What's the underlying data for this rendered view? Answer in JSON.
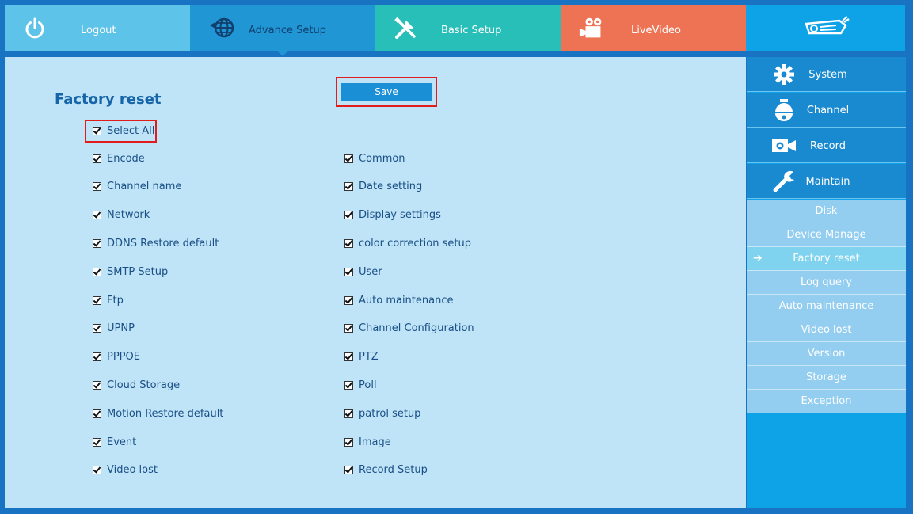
{
  "topnav": {
    "logout": "Logout",
    "advance_setup": "Advance Setup",
    "basic_setup": "Basic Setup",
    "live_video": "LiveVideo"
  },
  "main": {
    "title": "Factory reset",
    "save_label": "Save",
    "select_all": {
      "label": "Select All",
      "checked": true
    },
    "left_items": [
      {
        "label": "Encode",
        "checked": true
      },
      {
        "label": "Channel name",
        "checked": true
      },
      {
        "label": "Network",
        "checked": true
      },
      {
        "label": "DDNS Restore default",
        "checked": true
      },
      {
        "label": "SMTP Setup",
        "checked": true
      },
      {
        "label": "Ftp",
        "checked": true
      },
      {
        "label": "UPNP",
        "checked": true
      },
      {
        "label": "PPPOE",
        "checked": true
      },
      {
        "label": "Cloud Storage",
        "checked": true
      },
      {
        "label": "Motion Restore default",
        "checked": true
      },
      {
        "label": "Event",
        "checked": true
      },
      {
        "label": "Video lost",
        "checked": true
      }
    ],
    "right_items": [
      {
        "label": "Common",
        "checked": true
      },
      {
        "label": "Date setting",
        "checked": true
      },
      {
        "label": "Display settings",
        "checked": true
      },
      {
        "label": "color correction setup",
        "checked": true
      },
      {
        "label": "User",
        "checked": true
      },
      {
        "label": "Auto maintenance",
        "checked": true
      },
      {
        "label": "Channel Configuration",
        "checked": true
      },
      {
        "label": "PTZ",
        "checked": true
      },
      {
        "label": "Poll",
        "checked": true
      },
      {
        "label": "patrol setup",
        "checked": true
      },
      {
        "label": "Image",
        "checked": true
      },
      {
        "label": "Record Setup",
        "checked": true
      }
    ]
  },
  "sidebar": {
    "main_items": [
      {
        "label": "System",
        "icon": "gear-icon"
      },
      {
        "label": "Channel",
        "icon": "dome-camera-icon"
      },
      {
        "label": "Record",
        "icon": "video-camera-icon"
      },
      {
        "label": "Maintain",
        "icon": "wrench-icon"
      }
    ],
    "sub_items": [
      {
        "label": "Disk"
      },
      {
        "label": "Device Manage"
      },
      {
        "label": "Factory reset",
        "active": true
      },
      {
        "label": "Log query"
      },
      {
        "label": "Auto maintenance"
      },
      {
        "label": "Video lost"
      },
      {
        "label": "Version"
      },
      {
        "label": "Storage"
      },
      {
        "label": "Exception"
      }
    ],
    "active_arrow": "➔"
  },
  "colors": {
    "logout_tab": "#5ec3e9",
    "advance_tab": "#2196d4",
    "basic_tab": "#29bfb9",
    "live_tab": "#ee7355",
    "logo_tab": "#0ea2e6",
    "content_bg": "#bfe3f7",
    "highlight_frame": "#e21b1b"
  }
}
